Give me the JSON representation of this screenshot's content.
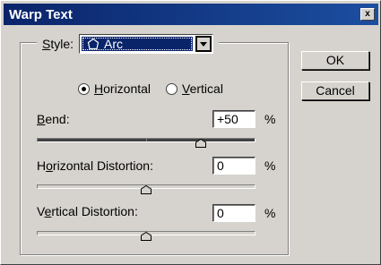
{
  "window": {
    "title": "Warp Text",
    "close_label": "x"
  },
  "style": {
    "label_pre": "",
    "label_u": "S",
    "label_post": "tyle:",
    "value": "Arc",
    "icon": "arc-icon"
  },
  "orientation": {
    "horizontal": {
      "pre": "",
      "u": "H",
      "post": "orizontal",
      "checked": true
    },
    "vertical": {
      "pre": "",
      "u": "V",
      "post": "ertical",
      "checked": false
    }
  },
  "bend": {
    "label_pre": "",
    "label_u": "B",
    "label_post": "end:",
    "value": "+50",
    "unit": "%",
    "slider_value": 50
  },
  "horizontal_distortion": {
    "label_pre": "H",
    "label_u": "o",
    "label_post": "rizontal Distortion:",
    "value": "0",
    "unit": "%",
    "slider_value": 0
  },
  "vertical_distortion": {
    "label_pre": "V",
    "label_u": "e",
    "label_post": "rtical Distortion:",
    "value": "0",
    "unit": "%",
    "slider_value": 0
  },
  "buttons": {
    "ok": "OK",
    "cancel": "Cancel"
  }
}
